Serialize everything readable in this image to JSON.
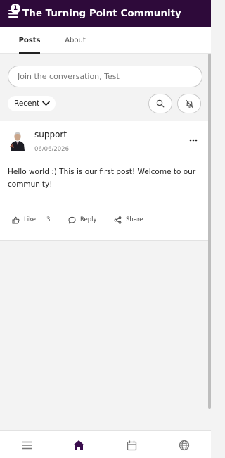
{
  "header": {
    "title": "The Turning Point Community",
    "notification_count": "1",
    "background_color": "#2e0a3a"
  },
  "tabs": [
    {
      "label": "Posts",
      "active": true
    },
    {
      "label": "About",
      "active": false
    }
  ],
  "composer": {
    "placeholder": "Join the conversation, Test"
  },
  "filters": {
    "sort_label": "Recent",
    "sort_icon": "chevron-down-icon",
    "search_icon": "search-icon",
    "notify_icon": "bell-off-icon"
  },
  "post": {
    "author": "support",
    "date": "06/06/2026",
    "body": "Hello world :) This is our first post! Welcome to our community!",
    "more_icon": "more-horizontal-icon",
    "actions": {
      "like_label": "Like",
      "like_count": "3",
      "reply_label": "Reply",
      "share_label": "Share"
    }
  },
  "bottom_nav": [
    {
      "icon": "menu-icon",
      "active": false
    },
    {
      "icon": "home-icon",
      "active": true
    },
    {
      "icon": "calendar-icon",
      "active": false
    },
    {
      "icon": "globe-icon",
      "active": false
    }
  ],
  "colors": {
    "accent": "#2e0a3a",
    "active_nav": "#3a0d4d"
  }
}
